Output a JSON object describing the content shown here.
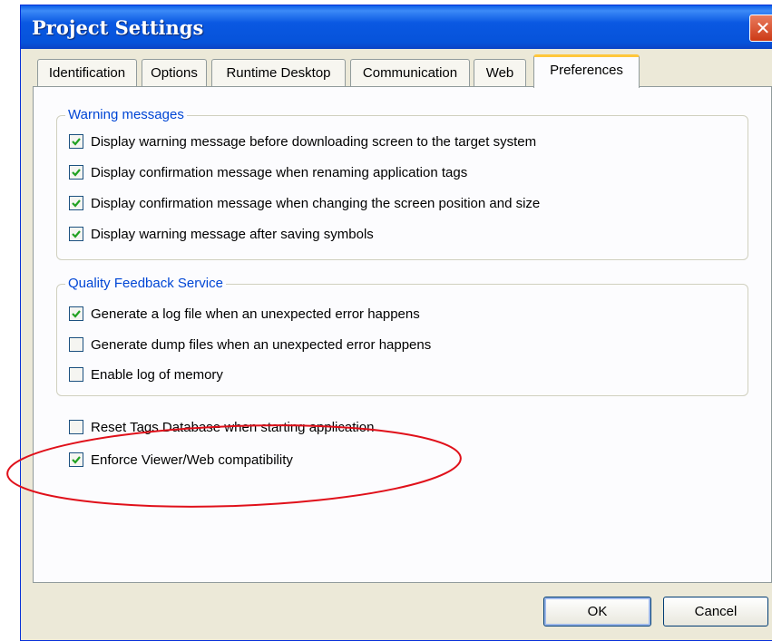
{
  "window": {
    "title": "Project Settings",
    "close_glyph": "✕"
  },
  "tabs": [
    {
      "label": "Identification",
      "active": false
    },
    {
      "label": "Options",
      "active": false
    },
    {
      "label": "Runtime Desktop",
      "active": false
    },
    {
      "label": "Communication",
      "active": false
    },
    {
      "label": "Web",
      "active": false
    },
    {
      "label": "Preferences",
      "active": true
    }
  ],
  "warning_group": {
    "title": "Warning messages",
    "items": [
      {
        "label": "Display warning message before downloading screen to the target system",
        "checked": true
      },
      {
        "label": "Display confirmation message when renaming application tags",
        "checked": true
      },
      {
        "label": "Display confirmation message when changing the screen position and size",
        "checked": true
      },
      {
        "label": "Display warning message after saving symbols",
        "checked": true
      }
    ]
  },
  "quality_group": {
    "title": "Quality Feedback Service",
    "items": [
      {
        "label": "Generate a log file when an unexpected error happens",
        "checked": true
      },
      {
        "label": "Generate dump files when an unexpected error happens",
        "checked": false
      },
      {
        "label": "Enable log of memory",
        "checked": false
      }
    ]
  },
  "options": [
    {
      "label": "Reset Tags Database when starting application",
      "checked": false
    },
    {
      "label": "Enforce Viewer/Web compatibility",
      "checked": true
    }
  ],
  "buttons": {
    "ok": "OK",
    "cancel": "Cancel"
  },
  "colors": {
    "titlebar": "#0a58e2",
    "group_title": "#0046d5",
    "active_tab_accent": "#ffc73c",
    "checkmark": "#21a121",
    "annotation_ellipse": "#e0101a"
  }
}
